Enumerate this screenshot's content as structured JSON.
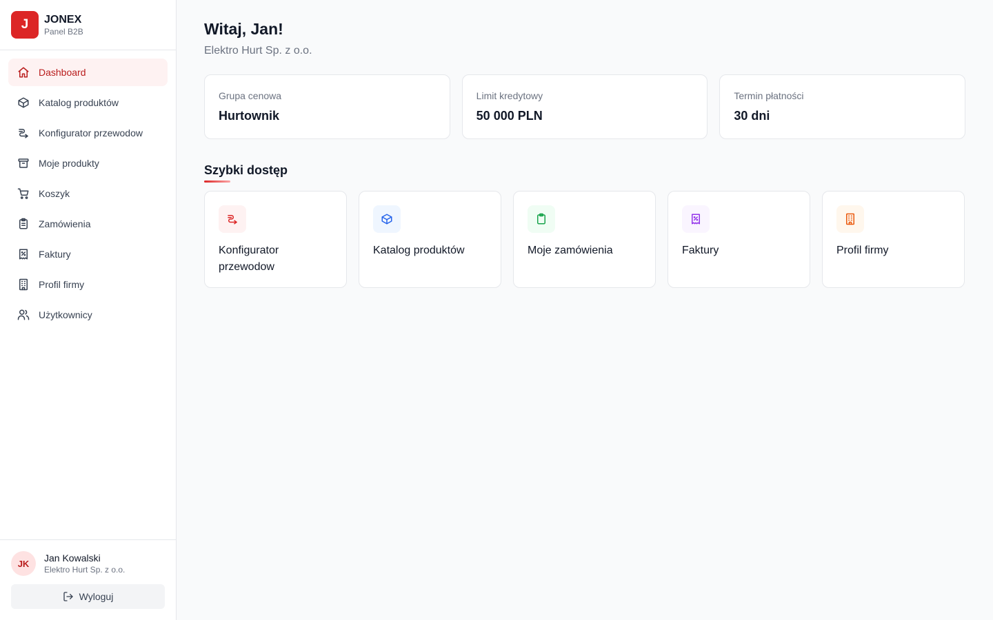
{
  "brand": {
    "logo_letter": "J",
    "name": "JONEX",
    "subtitle": "Panel B2B"
  },
  "sidebar": {
    "items": [
      {
        "label": "Dashboard",
        "icon": "home-icon",
        "active": true
      },
      {
        "label": "Katalog produktów",
        "icon": "box-icon"
      },
      {
        "label": "Konfigurator przewodow",
        "icon": "cable-icon"
      },
      {
        "label": "Moje produkty",
        "icon": "archive-icon"
      },
      {
        "label": "Koszyk",
        "icon": "cart-icon"
      },
      {
        "label": "Zamówienia",
        "icon": "clipboard-icon"
      },
      {
        "label": "Faktury",
        "icon": "receipt-icon"
      },
      {
        "label": "Profil firmy",
        "icon": "building-icon"
      },
      {
        "label": "Użytkownicy",
        "icon": "users-icon"
      }
    ]
  },
  "user": {
    "initials": "JK",
    "name": "Jan Kowalski",
    "company": "Elektro Hurt Sp. z o.o.",
    "logout_label": "Wyloguj"
  },
  "main": {
    "greeting": "Witaj, Jan!",
    "company": "Elektro Hurt Sp. z o.o.",
    "info_cards": [
      {
        "label": "Grupa cenowa",
        "value": "Hurtownik"
      },
      {
        "label": "Limit kredytowy",
        "value": "50 000 PLN"
      },
      {
        "label": "Termin płatności",
        "value": "30 dni"
      }
    ],
    "quick_title": "Szybki dostęp",
    "quick_links": [
      {
        "label": "Konfigurator przewodow",
        "icon": "cable-icon",
        "color": "#dc2626",
        "bg": "#fef2f2"
      },
      {
        "label": "Katalog produktów",
        "icon": "box-icon",
        "color": "#2563eb",
        "bg": "#eff6ff"
      },
      {
        "label": "Moje zamówienia",
        "icon": "clipboard-icon",
        "color": "#16a34a",
        "bg": "#f0fdf4"
      },
      {
        "label": "Faktury",
        "icon": "receipt-icon",
        "color": "#9333ea",
        "bg": "#faf5ff"
      },
      {
        "label": "Profil firmy",
        "icon": "building-icon",
        "color": "#ea580c",
        "bg": "#fff7ed"
      }
    ]
  },
  "colors": {
    "accent": "#dc2626",
    "active_bg": "#fef2f2",
    "active_text": "#b91c1c"
  }
}
